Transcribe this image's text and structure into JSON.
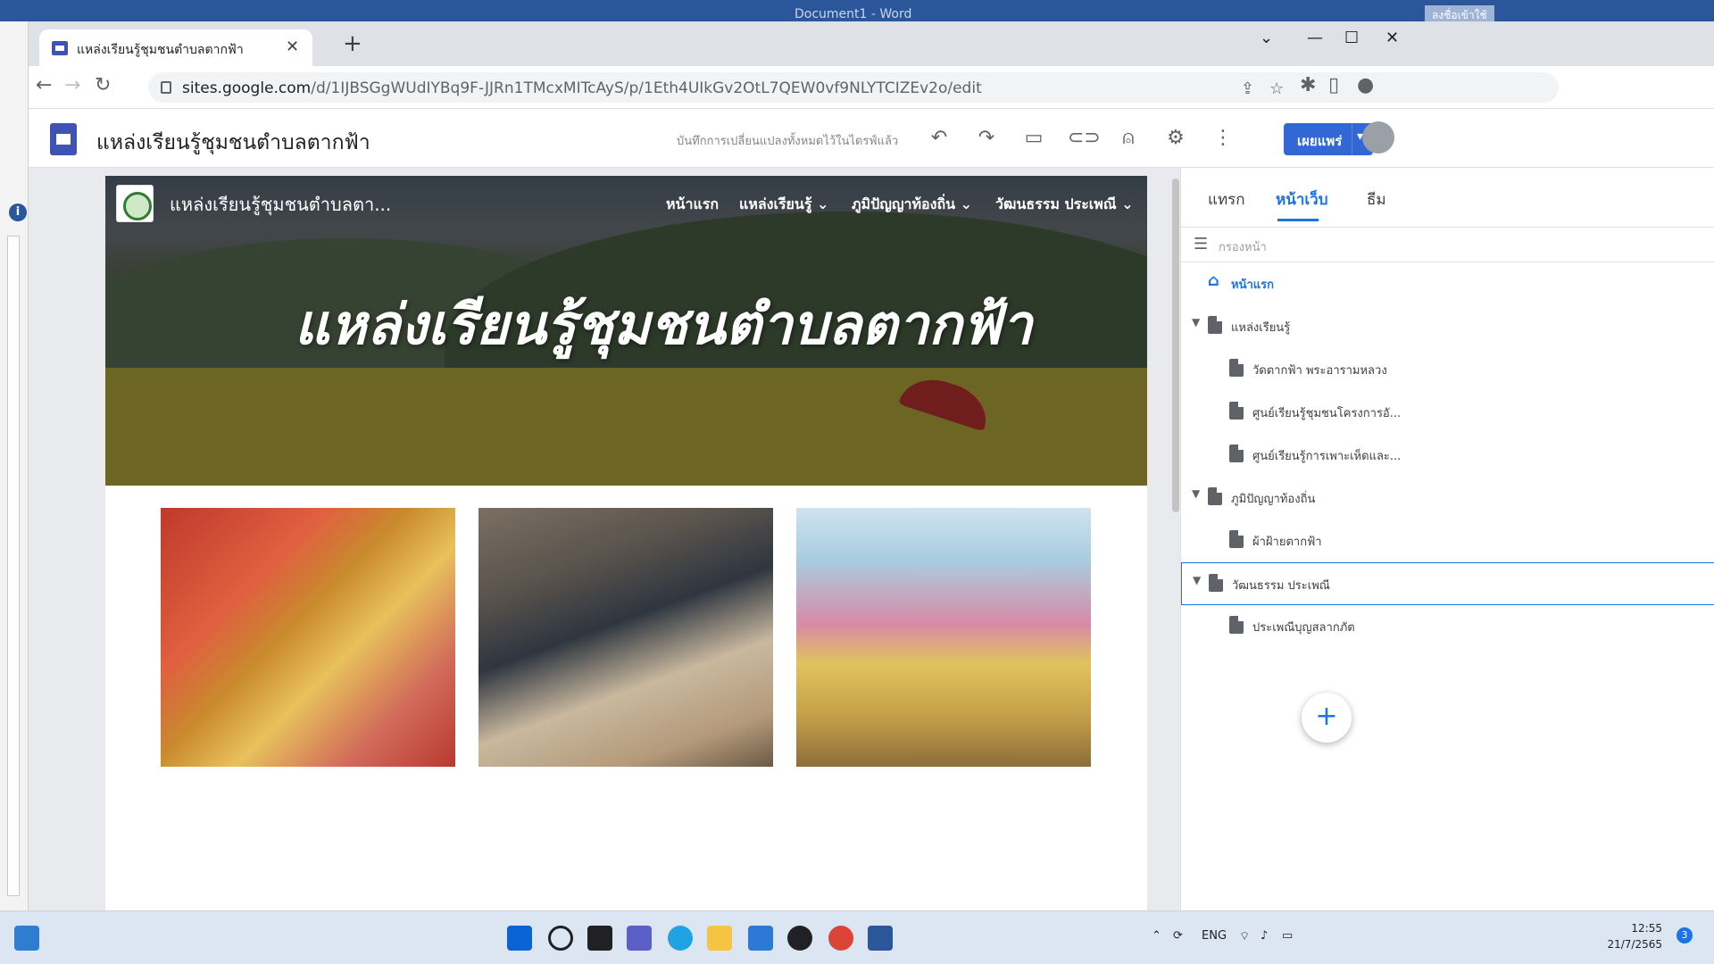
{
  "word": {
    "title": "Document1 - Word",
    "sign_in": "ลงชื่อเข้าใช้"
  },
  "browser": {
    "tab_title": "แหล่งเรียนรู้ชุมชนตำบลตากฟ้า",
    "url_host": "sites.google.com",
    "url_path": "/d/1IJBSGgWUdIYBq9F-JJRn1TMcxMITcAyS/p/1Eth4UIkGv2OtL7QEW0vf9NLYTCIZEv2o/edit"
  },
  "sites": {
    "site_title": "แหล่งเรียนรู้ชุมชนตำบลตากฟ้า",
    "saved_status": "บันทึกการเปลี่ยนแปลงทั้งหมดไว้ในไดรฟ์แล้ว",
    "publish_label": "เผยแพร่"
  },
  "hero": {
    "site_name": "แหล่งเรียนรู้ชุมชนตำบลตา...",
    "title": "แหล่งเรียนรู้ชุมชนตำบลตากฟ้า",
    "nav": [
      "หน้าแรก",
      "แหล่งเรียนรู้",
      "ภูมิปัญญาท้องถิ่น",
      "วัฒนธรรม ประเพณี"
    ]
  },
  "panel": {
    "tabs": [
      "แทรก",
      "หน้าเว็บ",
      "ธีม"
    ],
    "filter_placeholder": "กรองหน้า",
    "pages": [
      {
        "label": "หน้าแรก",
        "level": 0,
        "home": true
      },
      {
        "label": "แหล่งเรียนรู้",
        "level": 0,
        "expandable": true
      },
      {
        "label": "วัดตากฟ้า พระอารามหลวง",
        "level": 1
      },
      {
        "label": "ศูนย์เรียนรู้ชุมชนโครงการอั...",
        "level": 1
      },
      {
        "label": "ศูนย์เรียนรู้การเพาะเห็ดและ...",
        "level": 1
      },
      {
        "label": "ภูมิปัญญาท้องถิ่น",
        "level": 0,
        "expandable": true
      },
      {
        "label": "ผ้าฝ้ายตากฟ้า",
        "level": 1
      },
      {
        "label": "วัฒนธรรม ประเพณี",
        "level": 0,
        "expandable": true,
        "selected": true
      },
      {
        "label": "ประเพณีบุญสลากภัต",
        "level": 1
      }
    ]
  },
  "taskbar": {
    "lang": "ENG",
    "time": "12:55",
    "date": "21/7/2565",
    "notifications": "3"
  },
  "colors": {
    "accent": "#1a73e8",
    "publish": "#3367d6",
    "sites_logo": "#4052b5"
  }
}
